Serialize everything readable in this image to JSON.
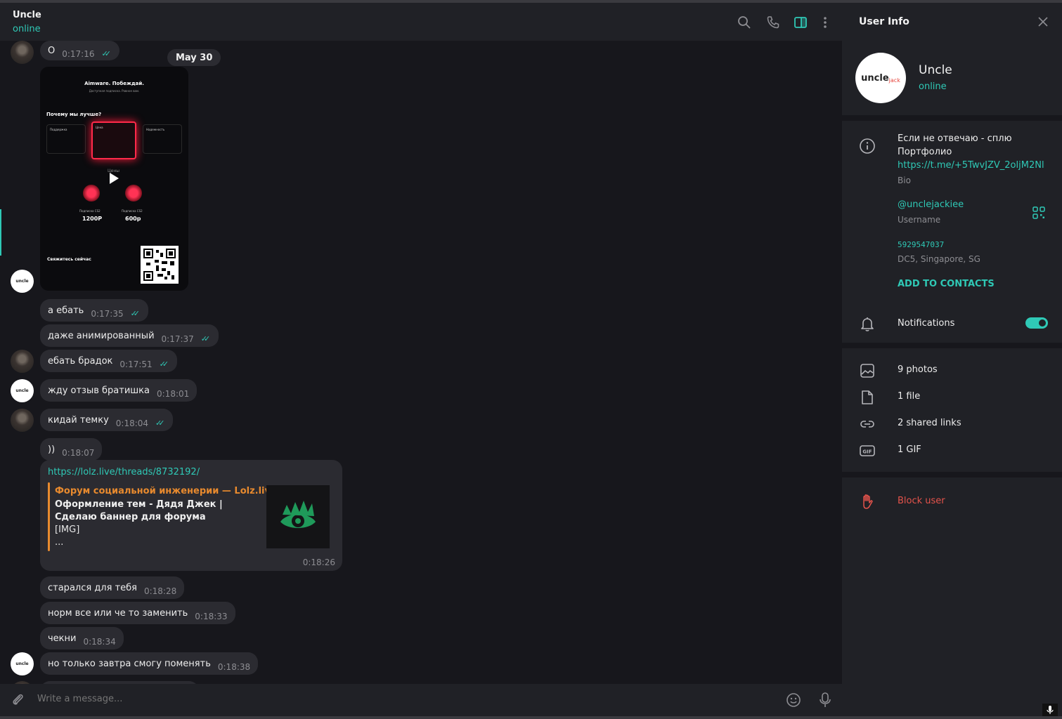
{
  "chat": {
    "title": "Uncle",
    "status": "online",
    "date_pill": "May 30",
    "composer_placeholder": "Write a message...",
    "messages": [
      {
        "text": "O",
        "time": "0:17:16",
        "read": true
      },
      {
        "text": "а ебать",
        "time": "0:17:35",
        "read": true
      },
      {
        "text": "даже анимированный",
        "time": "0:17:37",
        "read": true
      },
      {
        "text": "ебать брадок",
        "time": "0:17:51",
        "read": true
      },
      {
        "text": "жду отзыв братишка",
        "time": "0:18:01",
        "read": false
      },
      {
        "text": "кидай темку",
        "time": "0:18:04",
        "read": true
      },
      {
        "text": "))",
        "time": "0:18:07",
        "read": false
      },
      {
        "text": "старался для тебя",
        "time": "0:18:28",
        "read": false
      },
      {
        "text": "норм все или че то заменить",
        "time": "0:18:33",
        "read": false
      },
      {
        "text": "чекни",
        "time": "0:18:34",
        "read": false
      },
      {
        "text": "но только завтра смогу поменять",
        "time": "0:18:38",
        "read": false
      }
    ],
    "media": {
      "title": "Aimware. Побеждай.",
      "subtitle": "Доступная подписка. Ровное вам.",
      "why": "Почему мы лучше?",
      "card1": "Поддержка",
      "card2": "Цена",
      "card3": "Надежность",
      "prices_label": "Цены",
      "sub1": "Подписка CS2",
      "price1": "1200Р",
      "sub2": "Подписка CS2",
      "price2": "600р",
      "contact": "Свяжитесь сейчас"
    },
    "link_message": {
      "url": "https://lolz.live/threads/8732192/",
      "site": "Форум социальной инженерии — Lolz.live...",
      "title": "Оформление тем - Дядя Джек | Сделаю баннер для форума",
      "desc1": "[IMG]",
      "desc2": "...",
      "time": "0:18:26"
    }
  },
  "panel": {
    "title": "User Info",
    "avatar_text": "uncle",
    "avatar_sub": "jack",
    "name": "Uncle",
    "status": "online",
    "bio_line1": "Если не отвечаю - сплю",
    "bio_line2": "Портфолио",
    "bio_link": "https://t.me/+5TwvJZV_2oljM2Nl",
    "bio_label": "Bio",
    "username": "@unclejackiee",
    "username_label": "Username",
    "user_id": "5929547037",
    "dc_info": "DC5, Singapore, SG",
    "add_contacts": "ADD TO CONTACTS",
    "notifications": "Notifications",
    "media": [
      {
        "label": "9 photos",
        "icon": "photo-icon"
      },
      {
        "label": "1 file",
        "icon": "file-icon"
      },
      {
        "label": "2 shared links",
        "icon": "link-icon"
      },
      {
        "label": "1 GIF",
        "icon": "gif-icon"
      }
    ],
    "block_user": "Block user"
  },
  "colors": {
    "accent": "#2fc9b6",
    "danger": "#e5534b",
    "link_preview": "#e88a2e",
    "bubble": "#2b2b31",
    "background": "#17171c"
  }
}
